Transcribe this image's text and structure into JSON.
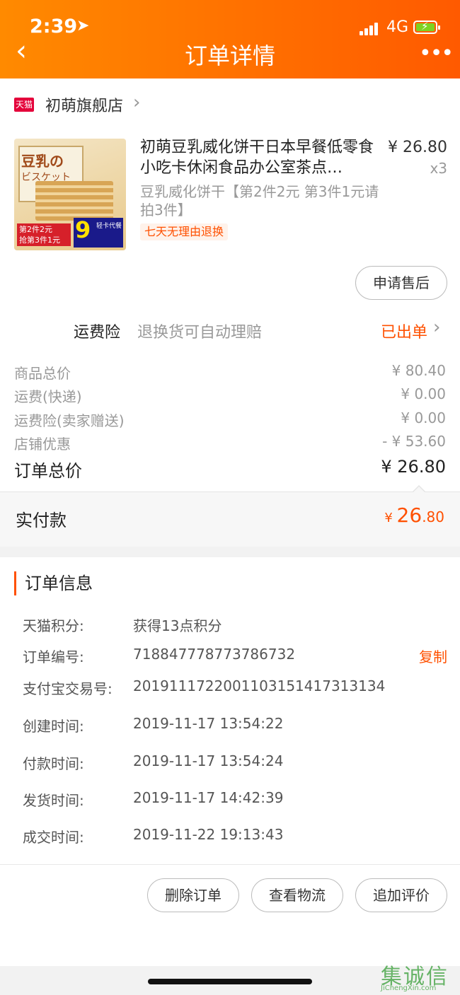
{
  "status_bar": {
    "time": "2:39",
    "network": "4G"
  },
  "header": {
    "title": "订单详情",
    "back_icon": "chevron-left-icon",
    "more_icon": "more-dots-icon"
  },
  "shop": {
    "badge": "天猫",
    "name": "初萌旗舰店"
  },
  "product": {
    "title": "初萌豆乳威化饼干日本早餐低零食小吃卡休闲食品办公室茶点…",
    "price": "¥ 26.80",
    "qty": "x3",
    "sku": "豆乳威化饼干【第2件2元 第3件1元请拍3件】",
    "tag": "七天无理由退换",
    "image_text": {
      "line1": "豆乳の",
      "line2": "ビスケット",
      "promo_line1": "第2件2元",
      "promo_line2": "抢第3件1元",
      "badge_big": "9",
      "badge_small": "轻卡代餐"
    }
  },
  "after_sale_button": "申请售后",
  "insurance": {
    "label": "运费险",
    "desc": "退换货可自动理赔",
    "status": "已出单"
  },
  "fees": [
    {
      "label": "商品总价",
      "value": "¥ 80.40"
    },
    {
      "label": "运费(快递)",
      "value": "¥ 0.00"
    },
    {
      "label": "运费险(卖家赠送)",
      "value": "¥ 0.00"
    },
    {
      "label": "店铺优惠",
      "value": "- ¥ 53.60"
    }
  ],
  "total": {
    "label": "订单总价",
    "value": "¥ 26.80"
  },
  "paid": {
    "label": "实付款",
    "currency": "¥ ",
    "integer": "26",
    "decimal": ".80"
  },
  "order_info": {
    "title": "订单信息",
    "rows": [
      {
        "key": "天猫积分:",
        "value": "获得13点积分"
      },
      {
        "key": "订单编号:",
        "value": "718847778773786732",
        "action": "复制"
      },
      {
        "key": "支付宝交易号:",
        "value": "2019111722001103151417313134"
      },
      {
        "key": "创建时间:",
        "value": "2019-11-17 13:54:22"
      },
      {
        "key": "付款时间:",
        "value": "2019-11-17 13:54:24"
      },
      {
        "key": "发货时间:",
        "value": "2019-11-17 14:42:39"
      },
      {
        "key": "成交时间:",
        "value": "2019-11-22 19:13:43"
      }
    ]
  },
  "actions": {
    "delete": "删除订单",
    "logistics": "查看物流",
    "review": "追加评价"
  },
  "watermark": {
    "big": "集诚信",
    "small": "JiChengXin.com"
  },
  "colors": {
    "accent": "#ff5000",
    "header_start": "#ff8a00",
    "header_end": "#ff5a00"
  }
}
